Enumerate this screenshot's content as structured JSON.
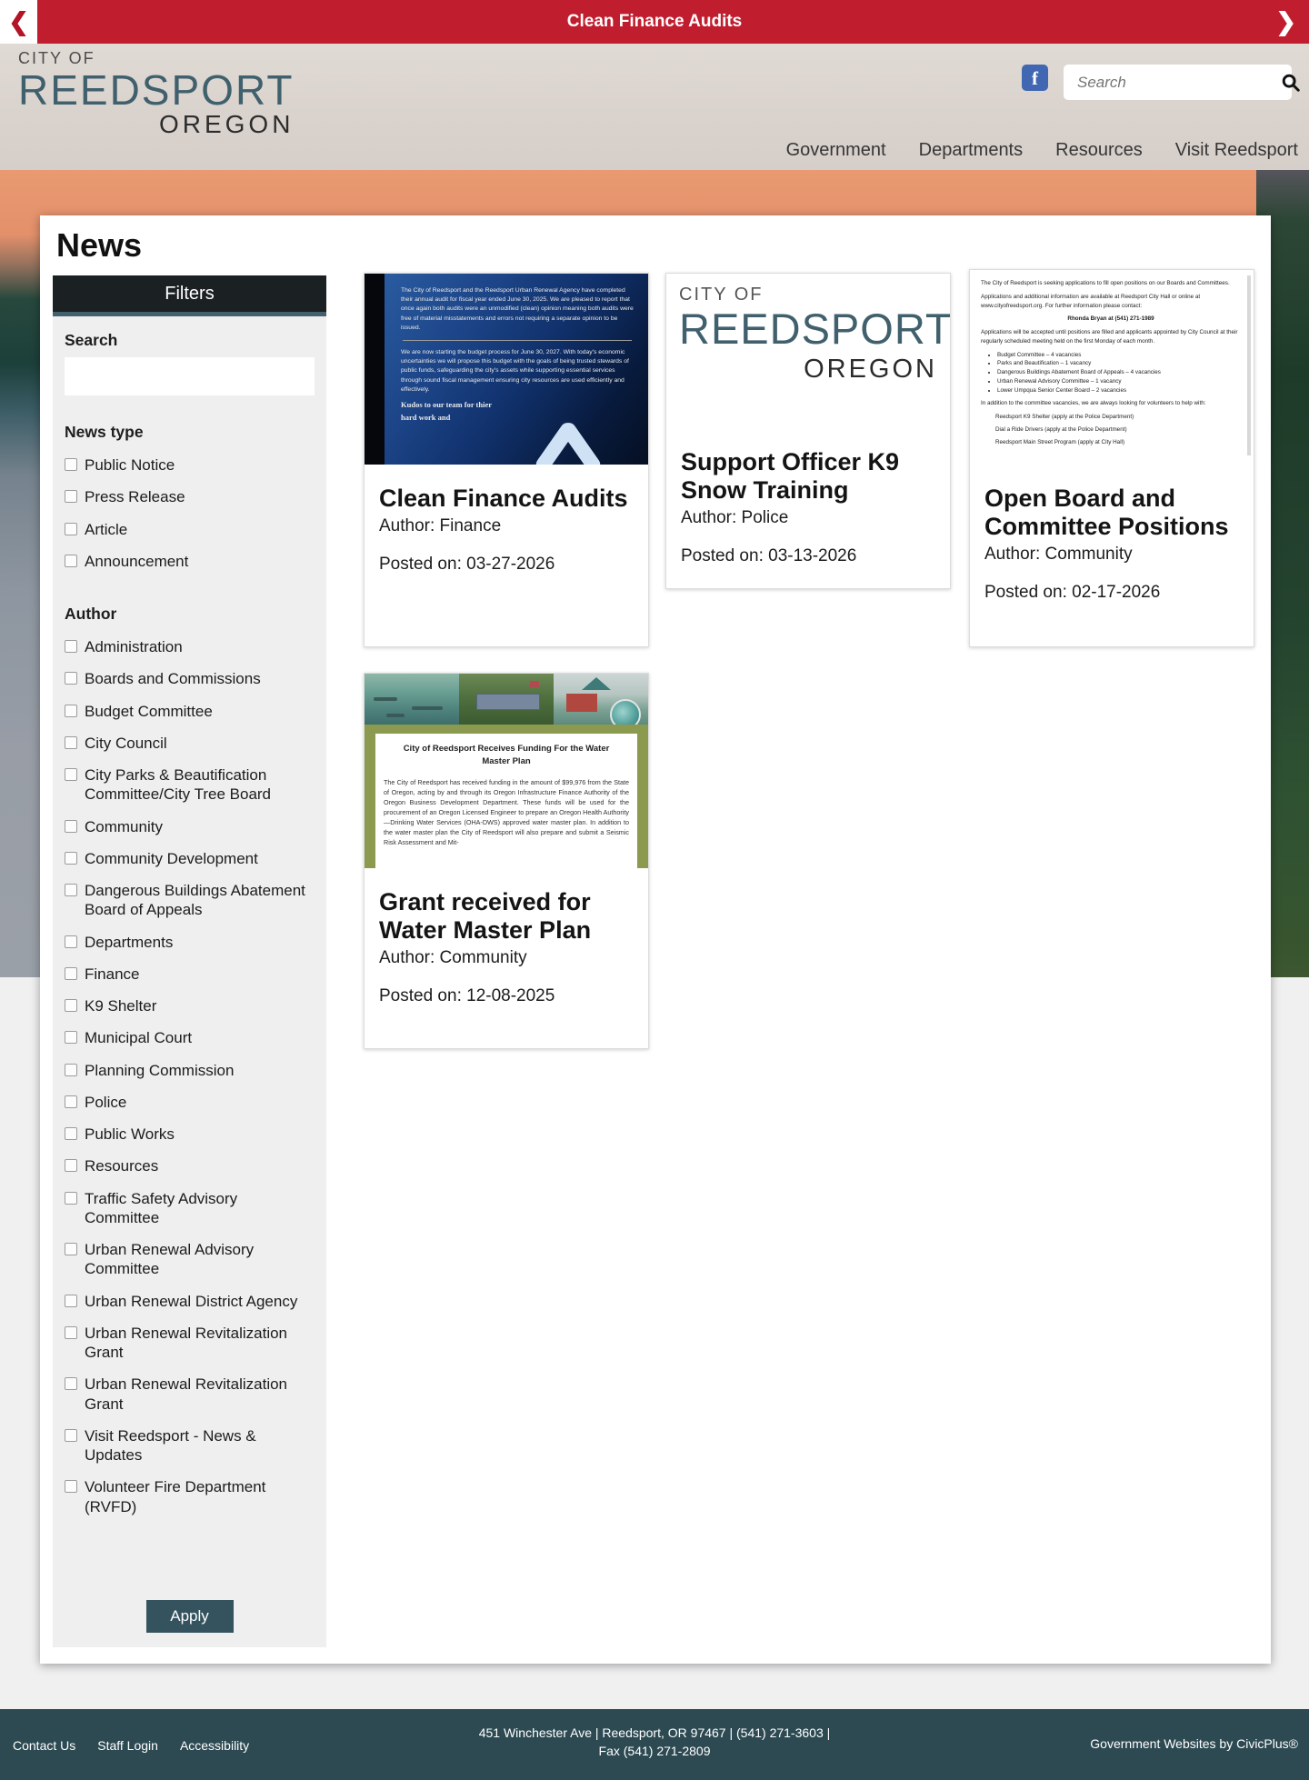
{
  "colors": {
    "alert_red": "#c01e2e",
    "logo_teal": "#40606d",
    "filters_header_dark": "#1b2023",
    "filters_accent_teal": "#42616c",
    "apply_teal": "#34535e",
    "footer_teal": "#2d4a53",
    "facebook_blue": "#4267b2"
  },
  "icons": {
    "prev": "❮",
    "next": "❯",
    "facebook": "f"
  },
  "banner": {
    "title": "Clean Finance Audits"
  },
  "header": {
    "logo": {
      "line1": "CITY OF",
      "line2": "REEDSPORT",
      "line3": "OREGON"
    },
    "search_placeholder": "Search",
    "nav": [
      "Government",
      "Departments",
      "Resources",
      "Visit Reedsport"
    ]
  },
  "page": {
    "title": "News"
  },
  "filters": {
    "title": "Filters",
    "search_label": "Search",
    "search_value": "",
    "news_type_label": "News type",
    "news_types": [
      "Public Notice",
      "Press Release",
      "Article",
      "Announcement"
    ],
    "author_label": "Author",
    "authors": [
      "Administration",
      "Boards and Commissions",
      "Budget Committee",
      "City Council",
      "City Parks & Beautification Committee/City Tree Board",
      "Community",
      "Community Development",
      "Dangerous Buildings Abatement Board of Appeals",
      "Departments",
      "Finance",
      "K9 Shelter",
      "Municipal Court",
      "Planning Commission",
      "Police",
      "Public Works",
      "Resources",
      "Traffic Safety Advisory Committee",
      "Urban Renewal Advisory Committee",
      "Urban Renewal District Agency",
      "Urban Renewal Revitalization Grant",
      "Urban Renewal Revitalization Grant",
      "Visit Reedsport - News & Updates",
      "Volunteer Fire Department (RVFD)"
    ],
    "apply_label": "Apply"
  },
  "cards": [
    {
      "title": "Clean Finance Audits",
      "author_line": "Author: Finance",
      "posted_line": "Posted on: 03-27-2026",
      "image": {
        "p1": "The City of Reedsport and the Reedsport Urban Renewal Agency have completed their annual audit for fiscal year ended June 30, 2025. We are pleased to report that once again both audits were an unmodified (clean) opinion meaning both audits were free of material misstatements and errors not requiring a separate opinion to be issued.",
        "p2": "We are now starting the budget process for June 30, 2027. With today's economic uncertainties we will propose this budget with the goals of being trusted stewards of public funds, safeguarding the city's assets while supporting essential services through sound fiscal management ensuring city resources are used efficiently and effectively.",
        "p3": "Kudos to our team for thier hard work and"
      }
    },
    {
      "title": "Support Officer K9 Snow Training",
      "author_line": "Author: Police",
      "posted_line": "Posted on: 03-13-2026",
      "image": {
        "logo1": "CITY OF",
        "logo2": "REEDSPORT",
        "logo3": "OREGON"
      }
    },
    {
      "title": "Open Board and Committee Positions",
      "author_line": "Author: Community",
      "posted_line": "Posted on: 02-17-2026",
      "image": {
        "p1": "The City of Reedsport is seeking applications to fill open positions on our Boards and Committees.",
        "p2": "Applications and additional information are available at Reedsport City Hall or online at www.cityofreedsport.org. For further information please contact:",
        "contact": "Rhonda Bryan at (541) 271-1989",
        "p3": "Applications will be accepted until positions are filled and applicants appointed by City Council at their regularly scheduled meeting held on the first Monday of each month.",
        "bullets": [
          "Budget Committee – 4 vacancies",
          "Parks and Beautification – 1 vacancy",
          "Dangerous Buildings Abatement Board of Appeals – 4 vacancies",
          "Urban Renewal Advisory Committee – 1 vacancy",
          "Lower Umpqua Senior Center Board – 2 vacancies"
        ],
        "p4": "In addition to the committee vacancies, we are always looking for volunteers to help with:",
        "v1": "Reedsport K9 Shelter (apply at the Police Department)",
        "v2": "Dial a Ride Drivers (apply at the Police Department)",
        "v3": "Reedsport Main Street Program (apply at City Hall)"
      }
    },
    {
      "title": "Grant received for Water Master Plan",
      "author_line": "Author: Community",
      "posted_line": "Posted on: 12-08-2025",
      "image": {
        "heading": "City of Reedsport Receives Funding For the Water Master Plan",
        "body": "The City of Reedsport has received funding in the amount of $99,976 from the State of Oregon, acting by and through its Oregon Infrastructure Finance Authority of the Oregon Business Development Department. These funds will be used for the procurement of an Oregon Licensed Engineer to prepare an Oregon Health Authority—Drinking Water Services (OHA-DWS) approved water master plan.  In addition to the water master plan the City of Reedsport will also prepare and submit a Seismic Risk Assessment and Mit-"
      }
    }
  ],
  "footer": {
    "links": [
      "Contact Us",
      "Staff Login",
      "Accessibility"
    ],
    "address": "451 Winchester Ave | Reedsport, OR 97467 | (541) 271-3603 | Fax (541) 271-2809",
    "credit": "Government Websites by CivicPlus®"
  }
}
